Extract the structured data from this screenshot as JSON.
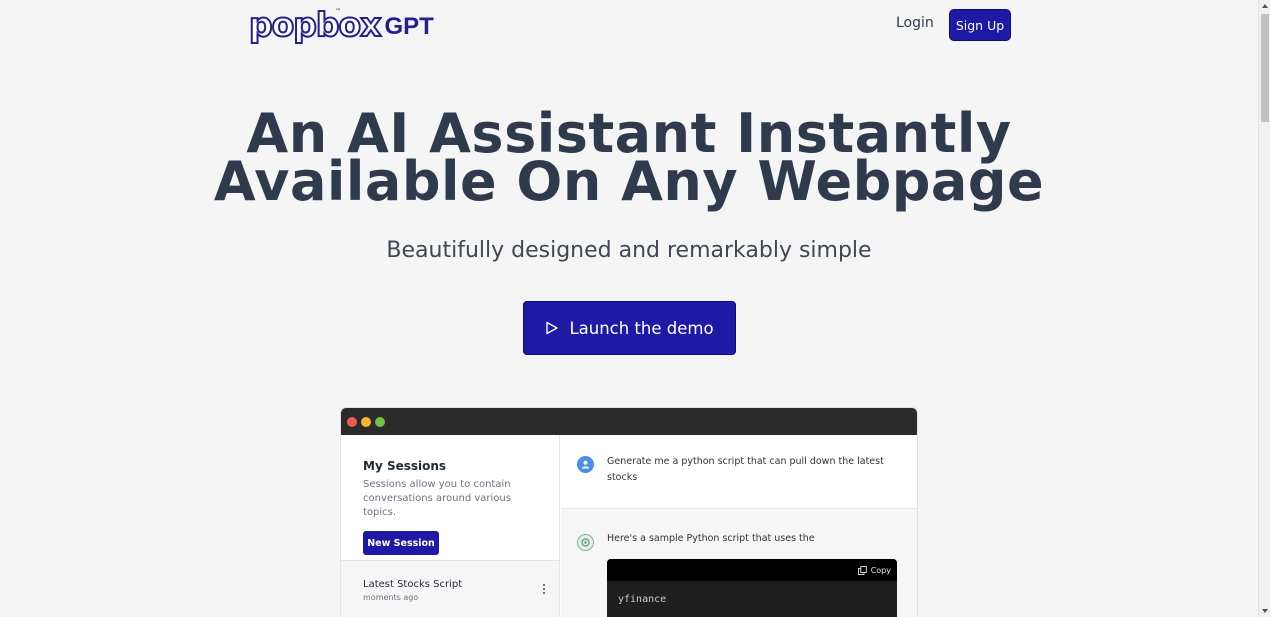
{
  "header": {
    "logo_text": "popbox",
    "logo_suffix": "GPT",
    "logo_tm": "™",
    "login_label": "Login",
    "signup_label": "Sign Up"
  },
  "hero": {
    "title_line1": "An AI Assistant Instantly",
    "title_line2": "Available On Any Webpage",
    "subtitle": "Beautifully designed and remarkably simple",
    "demo_button_label": "Launch the demo",
    "demo_button_icon": "play-icon"
  },
  "demo_window": {
    "sidebar": {
      "title": "My Sessions",
      "description": "Sessions allow you to contain conversations around various topics.",
      "new_session_label": "New Session",
      "sessions": [
        {
          "name": "Latest Stocks Script",
          "time": "moments ago"
        }
      ]
    },
    "chat": {
      "user_message": "Generate me a python script that can pull down the latest stocks",
      "bot_message": "Here's a sample Python script that uses the",
      "copy_label": "Copy",
      "code_text": "yfinance"
    }
  },
  "colors": {
    "brand": "#1e1aa6",
    "heading": "#2f3a4d",
    "background": "#f5f5f5"
  }
}
